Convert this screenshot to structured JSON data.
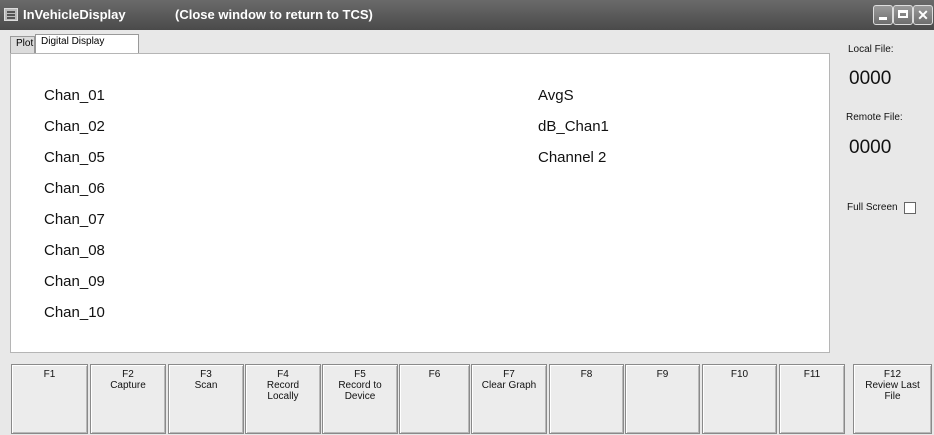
{
  "window": {
    "title": "InVehicleDisplay",
    "subtitle": "(Close window to return to TCS)"
  },
  "tabs": [
    {
      "label": "Plot",
      "active": false
    },
    {
      "label": "Digital Display",
      "active": true
    }
  ],
  "channels_left": [
    "Chan_01",
    "Chan_02",
    "Chan_05",
    "Chan_06",
    "Chan_07",
    "Chan_08",
    "Chan_09",
    "Chan_10"
  ],
  "channels_right": [
    "AvgS",
    "dB_Chan1",
    "Channel 2"
  ],
  "side": {
    "local_label": "Local File:",
    "local_value": "0000",
    "remote_label": "Remote File:",
    "remote_value": "0000",
    "fullscreen_label": "Full Screen",
    "fullscreen_checked": false
  },
  "fkeys": [
    "F1",
    "F2\nCapture",
    "F3\nScan",
    "F4\nRecord\nLocally",
    "F5\nRecord to\nDevice",
    "F6",
    "F7\nClear Graph",
    "F8",
    "F9",
    "F10",
    "F11",
    "F12\nReview Last\nFile"
  ]
}
